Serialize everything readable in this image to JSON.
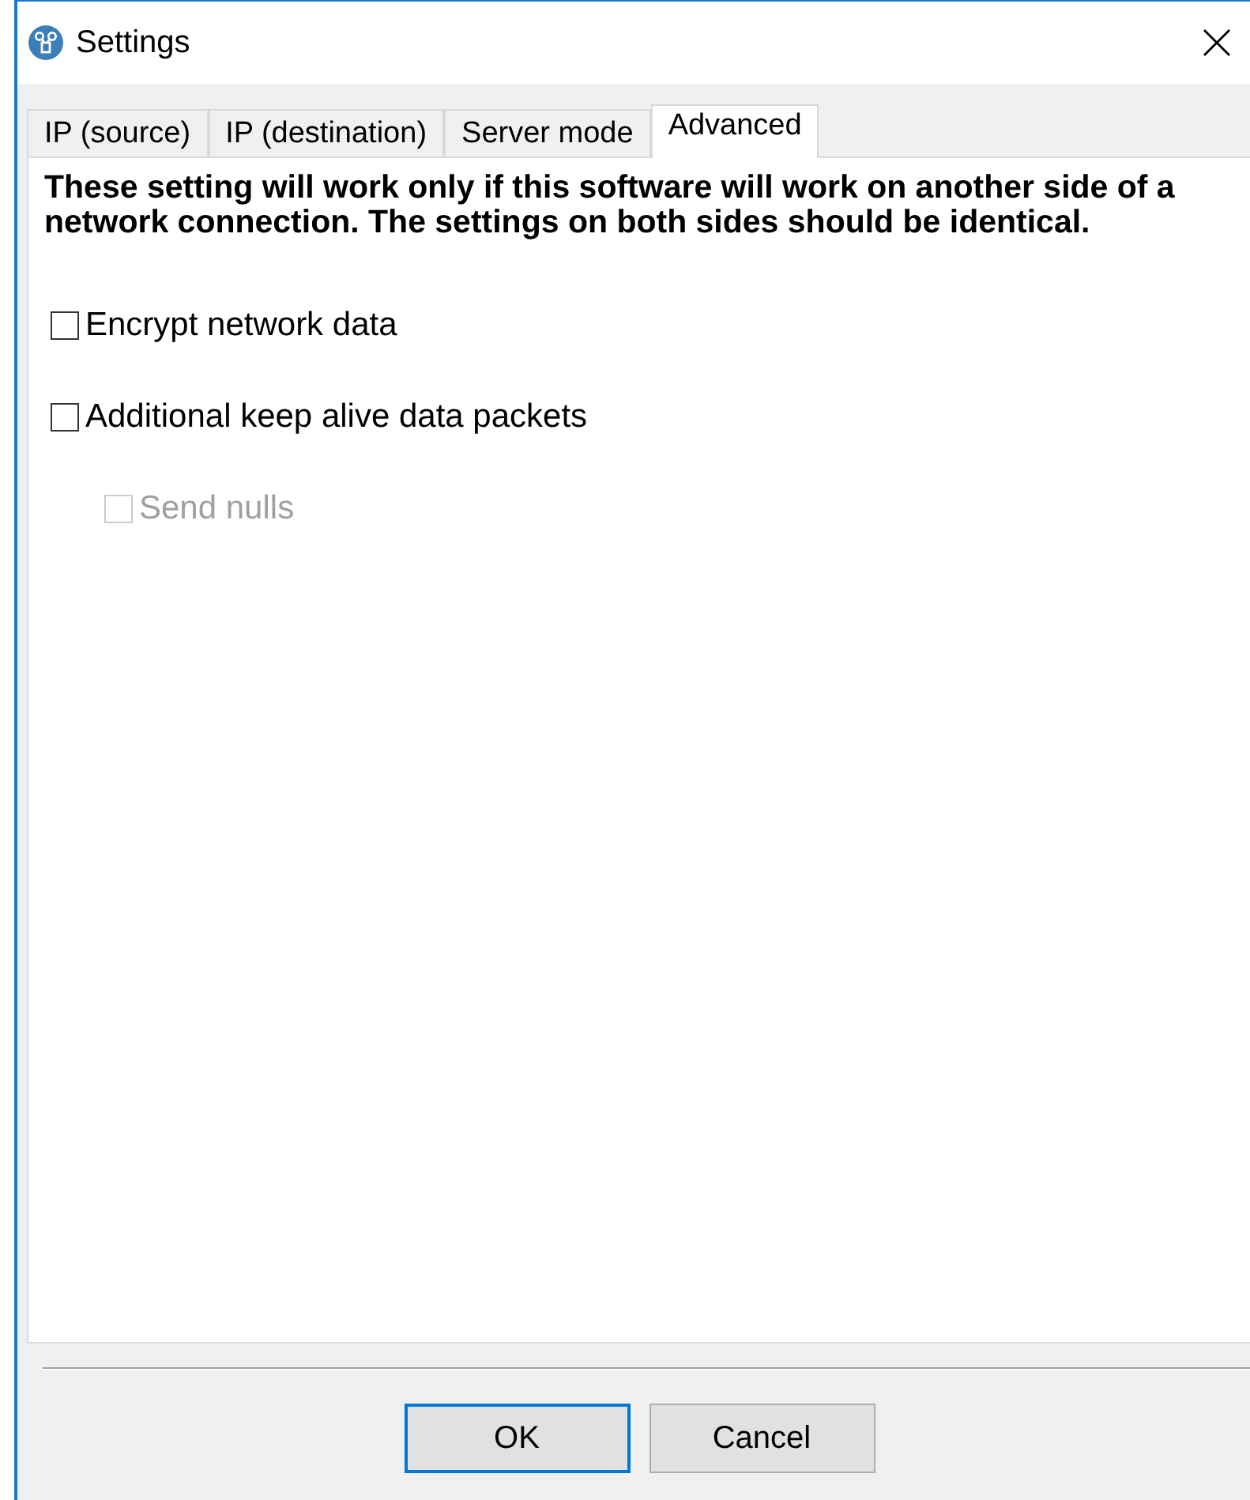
{
  "window": {
    "title": "Settings"
  },
  "tabs": [
    {
      "label": "IP (source)",
      "selected": false
    },
    {
      "label": "IP (destination)",
      "selected": false
    },
    {
      "label": "Server mode",
      "selected": false
    },
    {
      "label": "Advanced",
      "selected": true
    }
  ],
  "notice": "These setting will work only if this software will work on another side of a network connection. The settings on both sides should be identical.",
  "options": [
    {
      "label": "Encrypt network data",
      "checked": false,
      "disabled": false
    },
    {
      "label": "Additional keep alive data packets",
      "checked": false,
      "disabled": false,
      "children": [
        {
          "label": "Send nulls",
          "checked": false,
          "disabled": true
        }
      ]
    }
  ],
  "buttons": [
    {
      "label": "OK",
      "focused": true
    },
    {
      "label": "Cancel",
      "focused": false
    }
  ]
}
